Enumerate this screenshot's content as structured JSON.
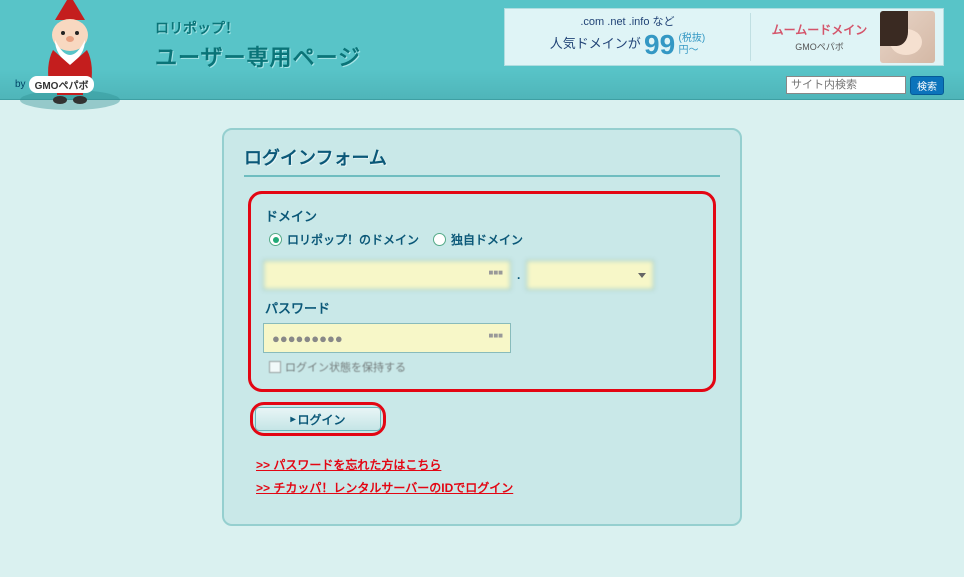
{
  "header": {
    "brand_line1": "ロリポップ！",
    "brand_line2": "ユーザー専用ページ",
    "by_label": "by",
    "by_company": "GMOペパボ"
  },
  "banner": {
    "domains_text": ".com .net .info など",
    "popular_text": "人気ドメインが",
    "price_number": "99",
    "price_tax": "(税抜)",
    "price_unit": "円～",
    "muu_title": "ムームードメイン",
    "muu_by": "GMOペパボ"
  },
  "search": {
    "placeholder": "サイト内検索",
    "button_label": "検索"
  },
  "login": {
    "panel_title": "ログインフォーム",
    "domain_label": "ドメイン",
    "radio_lolipop": "ロリポップ！のドメイン",
    "radio_own": "独自ドメイン",
    "subdomain_value": "",
    "domain_dot": ".",
    "domain_select_value": "",
    "password_label": "パスワード",
    "password_value": "●●●●●●●●●",
    "keep_label": "ログイン状態を保持する",
    "login_button": "ログイン",
    "link_forgot": ">>  パスワードを忘れた方はこちら",
    "link_chicappa": ">>  チカッパ！レンタルサーバーのIDでログイン"
  }
}
